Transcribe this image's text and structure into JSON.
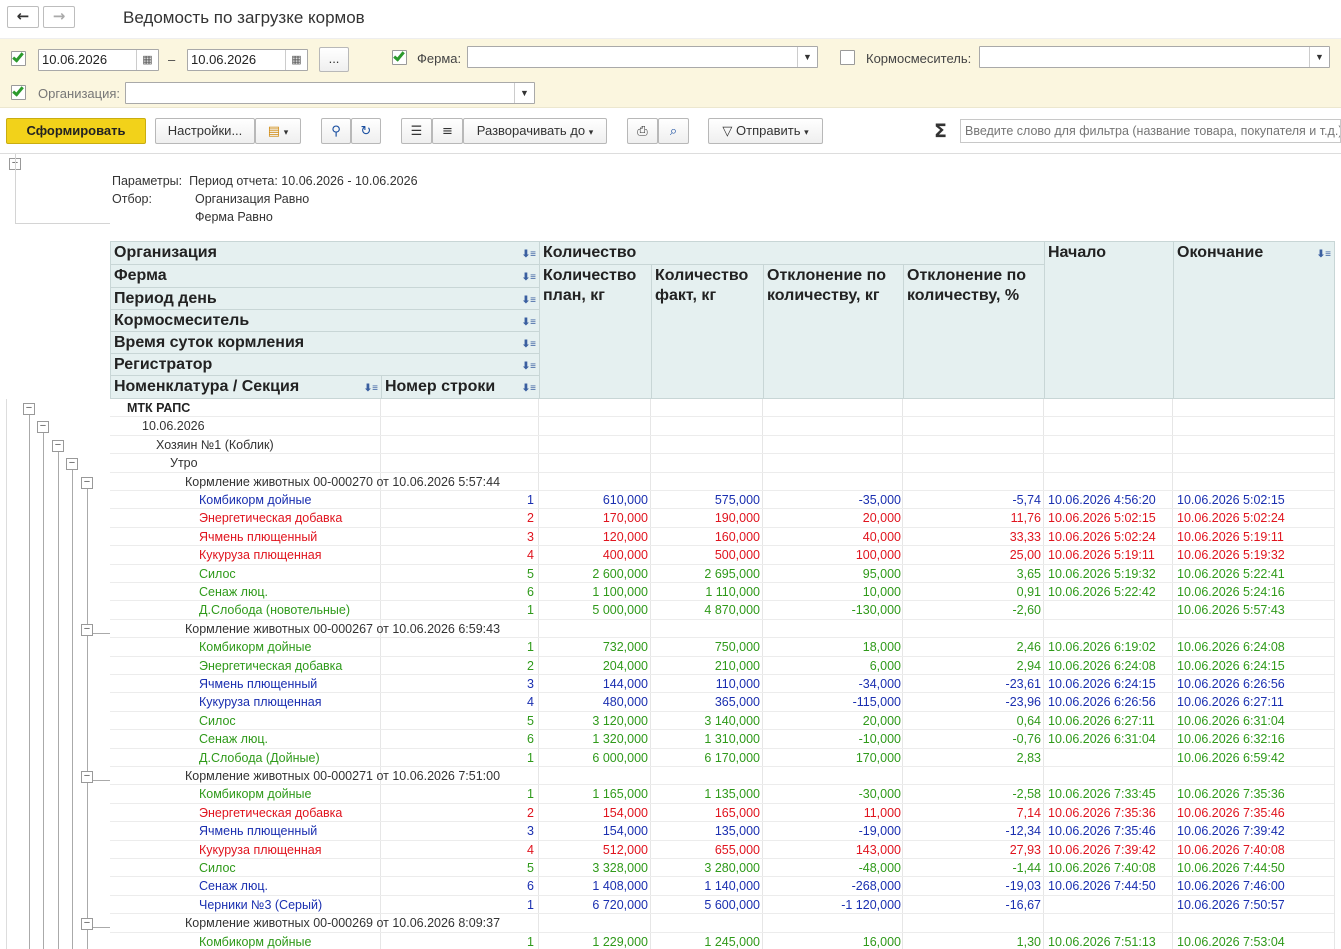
{
  "window": {
    "title": "Ведомость по загрузке кормов",
    "back_glyph": "←",
    "fwd_glyph": "→"
  },
  "filters": {
    "date_from": "10.06.2026",
    "date_sep": "–",
    "date_to": "10.06.2026",
    "period_btn": "...",
    "farm_label": "Ферма:",
    "farm_value": "",
    "mixer_label": "Кормосмеситель:",
    "mixer_value": "",
    "org_label": "Организация:",
    "org_value": ""
  },
  "toolbar": {
    "generate": "Сформировать",
    "settings": "Настройки...",
    "expand_to": "Разворачивать до",
    "send": "Отправить",
    "sigma": "Σ",
    "search_placeholder": "Введите слово для фильтра (название товара, покупателя и т.д.)"
  },
  "report": {
    "params_label": "Параметры:",
    "params_value": "Период отчета: 10.06.2026 - 10.06.2026",
    "filter_label": "Отбор:",
    "filter_1": "Организация Равно",
    "filter_2": "Ферма Равно",
    "header": {
      "group_org": "Организация",
      "group_farm": "Ферма",
      "group_day": "Период день",
      "group_mixer": "Кормосмеситель",
      "group_time": "Время суток кормления",
      "group_reg": "Регистратор",
      "group_nom": "Номенклатура / Секция",
      "line_no": "Номер строки",
      "quantity": "Количество",
      "plan": "Количество план, кг",
      "fact": "Количество факт, кг",
      "dev_kg": "Отклонение по количеству, кг",
      "dev_pct": "Отклонение по количеству, %",
      "start": "Начало",
      "end": "Окончание"
    },
    "groups": {
      "org": "МТК РАПС",
      "day": "10.06.2026",
      "mixer": "Хозяин №1 (Коблик)",
      "time": "Утро"
    },
    "colors": {
      "blue": "#1a2fb0",
      "red": "#e0141e",
      "green": "#2f9a1a"
    },
    "registrars": [
      {
        "title": "Кормление животных 00-000270 от 10.06.2026 5:57:44",
        "rows": [
          {
            "name": "Комбикорм дойные",
            "n": "1",
            "plan": "610,000",
            "fact": "575,000",
            "dkg": "-35,000",
            "dpct": "-5,74",
            "start": "10.06.2026 4:56:20",
            "end": "10.06.2026 5:02:15",
            "color": "blue"
          },
          {
            "name": "Энергетическая добавка",
            "n": "2",
            "plan": "170,000",
            "fact": "190,000",
            "dkg": "20,000",
            "dpct": "11,76",
            "start": "10.06.2026 5:02:15",
            "end": "10.06.2026 5:02:24",
            "color": "red"
          },
          {
            "name": "Ячмень плющенный",
            "n": "3",
            "plan": "120,000",
            "fact": "160,000",
            "dkg": "40,000",
            "dpct": "33,33",
            "start": "10.06.2026 5:02:24",
            "end": "10.06.2026 5:19:11",
            "color": "red"
          },
          {
            "name": "Кукуруза плющенная",
            "n": "4",
            "plan": "400,000",
            "fact": "500,000",
            "dkg": "100,000",
            "dpct": "25,00",
            "start": "10.06.2026 5:19:11",
            "end": "10.06.2026 5:19:32",
            "color": "red"
          },
          {
            "name": "Силос",
            "n": "5",
            "plan": "2 600,000",
            "fact": "2 695,000",
            "dkg": "95,000",
            "dpct": "3,65",
            "start": "10.06.2026 5:19:32",
            "end": "10.06.2026 5:22:41",
            "color": "green"
          },
          {
            "name": "Сенаж люц.",
            "n": "6",
            "plan": "1 100,000",
            "fact": "1 110,000",
            "dkg": "10,000",
            "dpct": "0,91",
            "start": "10.06.2026 5:22:42",
            "end": "10.06.2026 5:24:16",
            "color": "green"
          },
          {
            "name": "Д.Слобода (новотельные)",
            "n": "1",
            "plan": "5 000,000",
            "fact": "4 870,000",
            "dkg": "-130,000",
            "dpct": "-2,60",
            "start": "",
            "end": "10.06.2026 5:57:43",
            "color": "green"
          }
        ]
      },
      {
        "title": "Кормление животных 00-000267 от 10.06.2026 6:59:43",
        "rows": [
          {
            "name": "Комбикорм дойные",
            "n": "1",
            "plan": "732,000",
            "fact": "750,000",
            "dkg": "18,000",
            "dpct": "2,46",
            "start": "10.06.2026 6:19:02",
            "end": "10.06.2026 6:24:08",
            "color": "green"
          },
          {
            "name": "Энергетическая добавка",
            "n": "2",
            "plan": "204,000",
            "fact": "210,000",
            "dkg": "6,000",
            "dpct": "2,94",
            "start": "10.06.2026 6:24:08",
            "end": "10.06.2026 6:24:15",
            "color": "green"
          },
          {
            "name": "Ячмень плющенный",
            "n": "3",
            "plan": "144,000",
            "fact": "110,000",
            "dkg": "-34,000",
            "dpct": "-23,61",
            "start": "10.06.2026 6:24:15",
            "end": "10.06.2026 6:26:56",
            "color": "blue"
          },
          {
            "name": "Кукуруза плющенная",
            "n": "4",
            "plan": "480,000",
            "fact": "365,000",
            "dkg": "-115,000",
            "dpct": "-23,96",
            "start": "10.06.2026 6:26:56",
            "end": "10.06.2026 6:27:11",
            "color": "blue"
          },
          {
            "name": "Силос",
            "n": "5",
            "plan": "3 120,000",
            "fact": "3 140,000",
            "dkg": "20,000",
            "dpct": "0,64",
            "start": "10.06.2026 6:27:11",
            "end": "10.06.2026 6:31:04",
            "color": "green"
          },
          {
            "name": "Сенаж люц.",
            "n": "6",
            "plan": "1 320,000",
            "fact": "1 310,000",
            "dkg": "-10,000",
            "dpct": "-0,76",
            "start": "10.06.2026 6:31:04",
            "end": "10.06.2026 6:32:16",
            "color": "green"
          },
          {
            "name": "Д.Слобода (Дойные)",
            "n": "1",
            "plan": "6 000,000",
            "fact": "6 170,000",
            "dkg": "170,000",
            "dpct": "2,83",
            "start": "",
            "end": "10.06.2026 6:59:42",
            "color": "green"
          }
        ]
      },
      {
        "title": "Кормление животных 00-000271 от 10.06.2026 7:51:00",
        "rows": [
          {
            "name": "Комбикорм дойные",
            "n": "1",
            "plan": "1 165,000",
            "fact": "1 135,000",
            "dkg": "-30,000",
            "dpct": "-2,58",
            "start": "10.06.2026 7:33:45",
            "end": "10.06.2026 7:35:36",
            "color": "green"
          },
          {
            "name": "Энергетическая добавка",
            "n": "2",
            "plan": "154,000",
            "fact": "165,000",
            "dkg": "11,000",
            "dpct": "7,14",
            "start": "10.06.2026 7:35:36",
            "end": "10.06.2026 7:35:46",
            "color": "red"
          },
          {
            "name": "Ячмень плющенный",
            "n": "3",
            "plan": "154,000",
            "fact": "135,000",
            "dkg": "-19,000",
            "dpct": "-12,34",
            "start": "10.06.2026 7:35:46",
            "end": "10.06.2026 7:39:42",
            "color": "blue"
          },
          {
            "name": "Кукуруза плющенная",
            "n": "4",
            "plan": "512,000",
            "fact": "655,000",
            "dkg": "143,000",
            "dpct": "27,93",
            "start": "10.06.2026 7:39:42",
            "end": "10.06.2026 7:40:08",
            "color": "red"
          },
          {
            "name": "Силос",
            "n": "5",
            "plan": "3 328,000",
            "fact": "3 280,000",
            "dkg": "-48,000",
            "dpct": "-1,44",
            "start": "10.06.2026 7:40:08",
            "end": "10.06.2026 7:44:50",
            "color": "green"
          },
          {
            "name": "Сенаж люц.",
            "n": "6",
            "plan": "1 408,000",
            "fact": "1 140,000",
            "dkg": "-268,000",
            "dpct": "-19,03",
            "start": "10.06.2026 7:44:50",
            "end": "10.06.2026 7:46:00",
            "color": "blue"
          },
          {
            "name": "Черники №3 (Серый)",
            "n": "1",
            "plan": "6 720,000",
            "fact": "5 600,000",
            "dkg": "-1 120,000",
            "dpct": "-16,67",
            "start": "",
            "end": "10.06.2026 7:50:57",
            "color": "blue"
          }
        ]
      },
      {
        "title": "Кормление животных 00-000269 от 10.06.2026 8:09:37",
        "rows": [
          {
            "name": "Комбикорм дойные",
            "n": "1",
            "plan": "1 229,000",
            "fact": "1 245,000",
            "dkg": "16,000",
            "dpct": "1,30",
            "start": "10.06.2026 7:51:13",
            "end": "10.06.2026 7:53:04",
            "color": "green"
          }
        ]
      }
    ]
  }
}
